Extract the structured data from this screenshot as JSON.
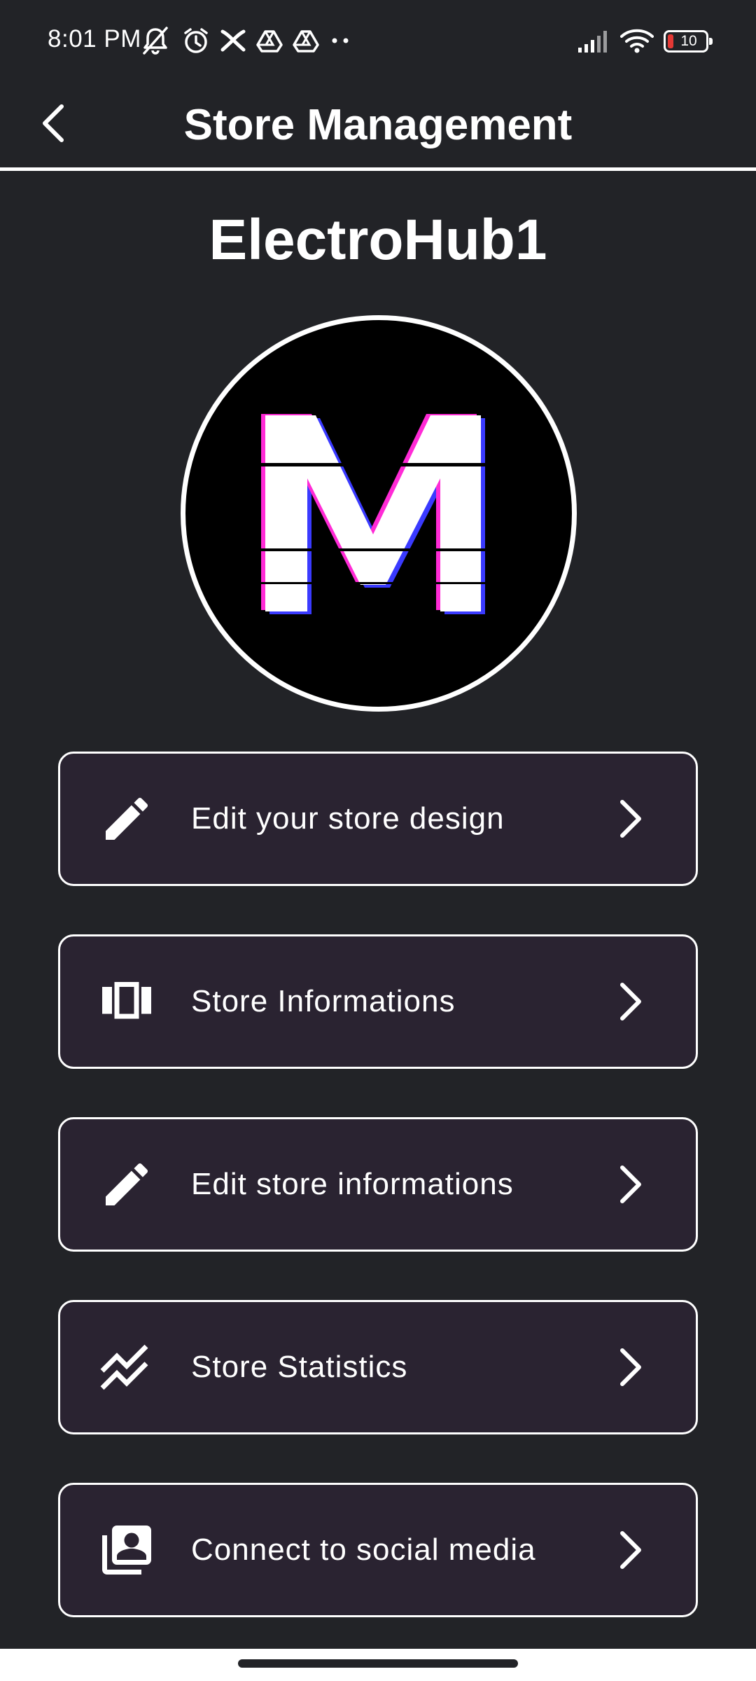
{
  "status_bar": {
    "time": "8:01 PM",
    "battery_level": "10",
    "icons": [
      "mute-icon",
      "alarm-icon",
      "app-notification-icon",
      "drive-icon",
      "drive-icon",
      "more-dots-icon",
      "signal-icon",
      "wifi-icon",
      "battery-icon"
    ]
  },
  "app_bar": {
    "title": "Store Management",
    "back_icon": "chevron-left-icon"
  },
  "store": {
    "name": "ElectroHub1",
    "logo_letter": "M"
  },
  "menu": {
    "items": [
      {
        "label": "Edit your store design",
        "icon": "pencil-icon"
      },
      {
        "label": "Store Informations",
        "icon": "carousel-icon"
      },
      {
        "label": "Edit store informations",
        "icon": "pencil-icon"
      },
      {
        "label": "Store Statistics",
        "icon": "trending-chart-icon"
      },
      {
        "label": "Connect to social media",
        "icon": "contacts-stack-icon"
      }
    ],
    "chevron_icon": "chevron-right-icon"
  },
  "colors": {
    "background": "#222327",
    "card_background": "#2a2331",
    "border": "#ffffff",
    "text": "#ffffff",
    "battery_low": "#e53935",
    "logo_glitch_magenta": "#ff2bd6",
    "logo_glitch_blue": "#3a3aff"
  }
}
